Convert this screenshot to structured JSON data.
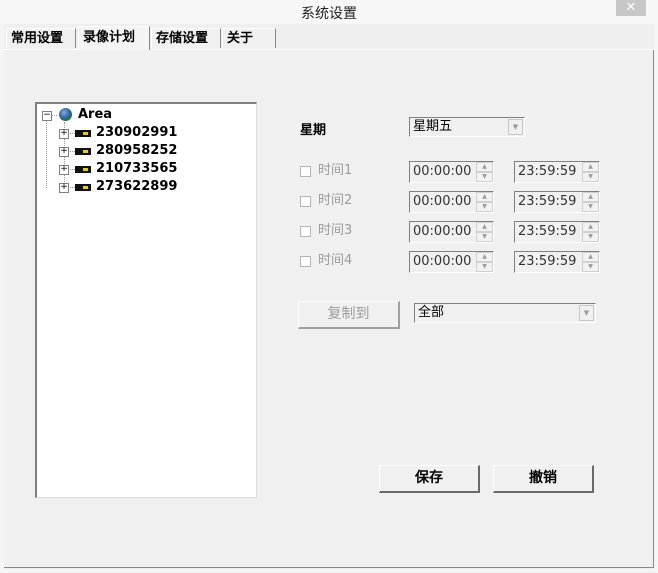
{
  "window": {
    "title": "系统设置",
    "close_glyph": "✕"
  },
  "tabs": [
    {
      "label": "常用设置",
      "active": false
    },
    {
      "label": "录像计划",
      "active": true
    },
    {
      "label": "存储设置",
      "active": false
    },
    {
      "label": "关于",
      "active": false
    }
  ],
  "tree": {
    "root": {
      "label": "Area",
      "expander": "−",
      "icon": "globe-icon"
    },
    "devices": [
      {
        "label": "230902991",
        "expander": "+",
        "icon": "device-icon"
      },
      {
        "label": "280958252",
        "expander": "+",
        "icon": "device-icon"
      },
      {
        "label": "210733565",
        "expander": "+",
        "icon": "device-icon"
      },
      {
        "label": "273622899",
        "expander": "+",
        "icon": "device-icon"
      }
    ]
  },
  "schedule": {
    "weekday_label": "星期",
    "weekday_value": "星期五",
    "periods": [
      {
        "label": "时间1",
        "start": "00:00:00",
        "end": "23:59:59",
        "checked": false
      },
      {
        "label": "时间2",
        "start": "00:00:00",
        "end": "23:59:59",
        "checked": false
      },
      {
        "label": "时间3",
        "start": "00:00:00",
        "end": "23:59:59",
        "checked": false
      },
      {
        "label": "时间4",
        "start": "00:00:00",
        "end": "23:59:59",
        "checked": false
      }
    ],
    "copy_button": "复制到",
    "copy_target": "全部"
  },
  "actions": {
    "save": "保存",
    "cancel": "撤销"
  },
  "glyphs": {
    "dropdown": "▼",
    "spin_up": "▲",
    "spin_down": "▼"
  }
}
